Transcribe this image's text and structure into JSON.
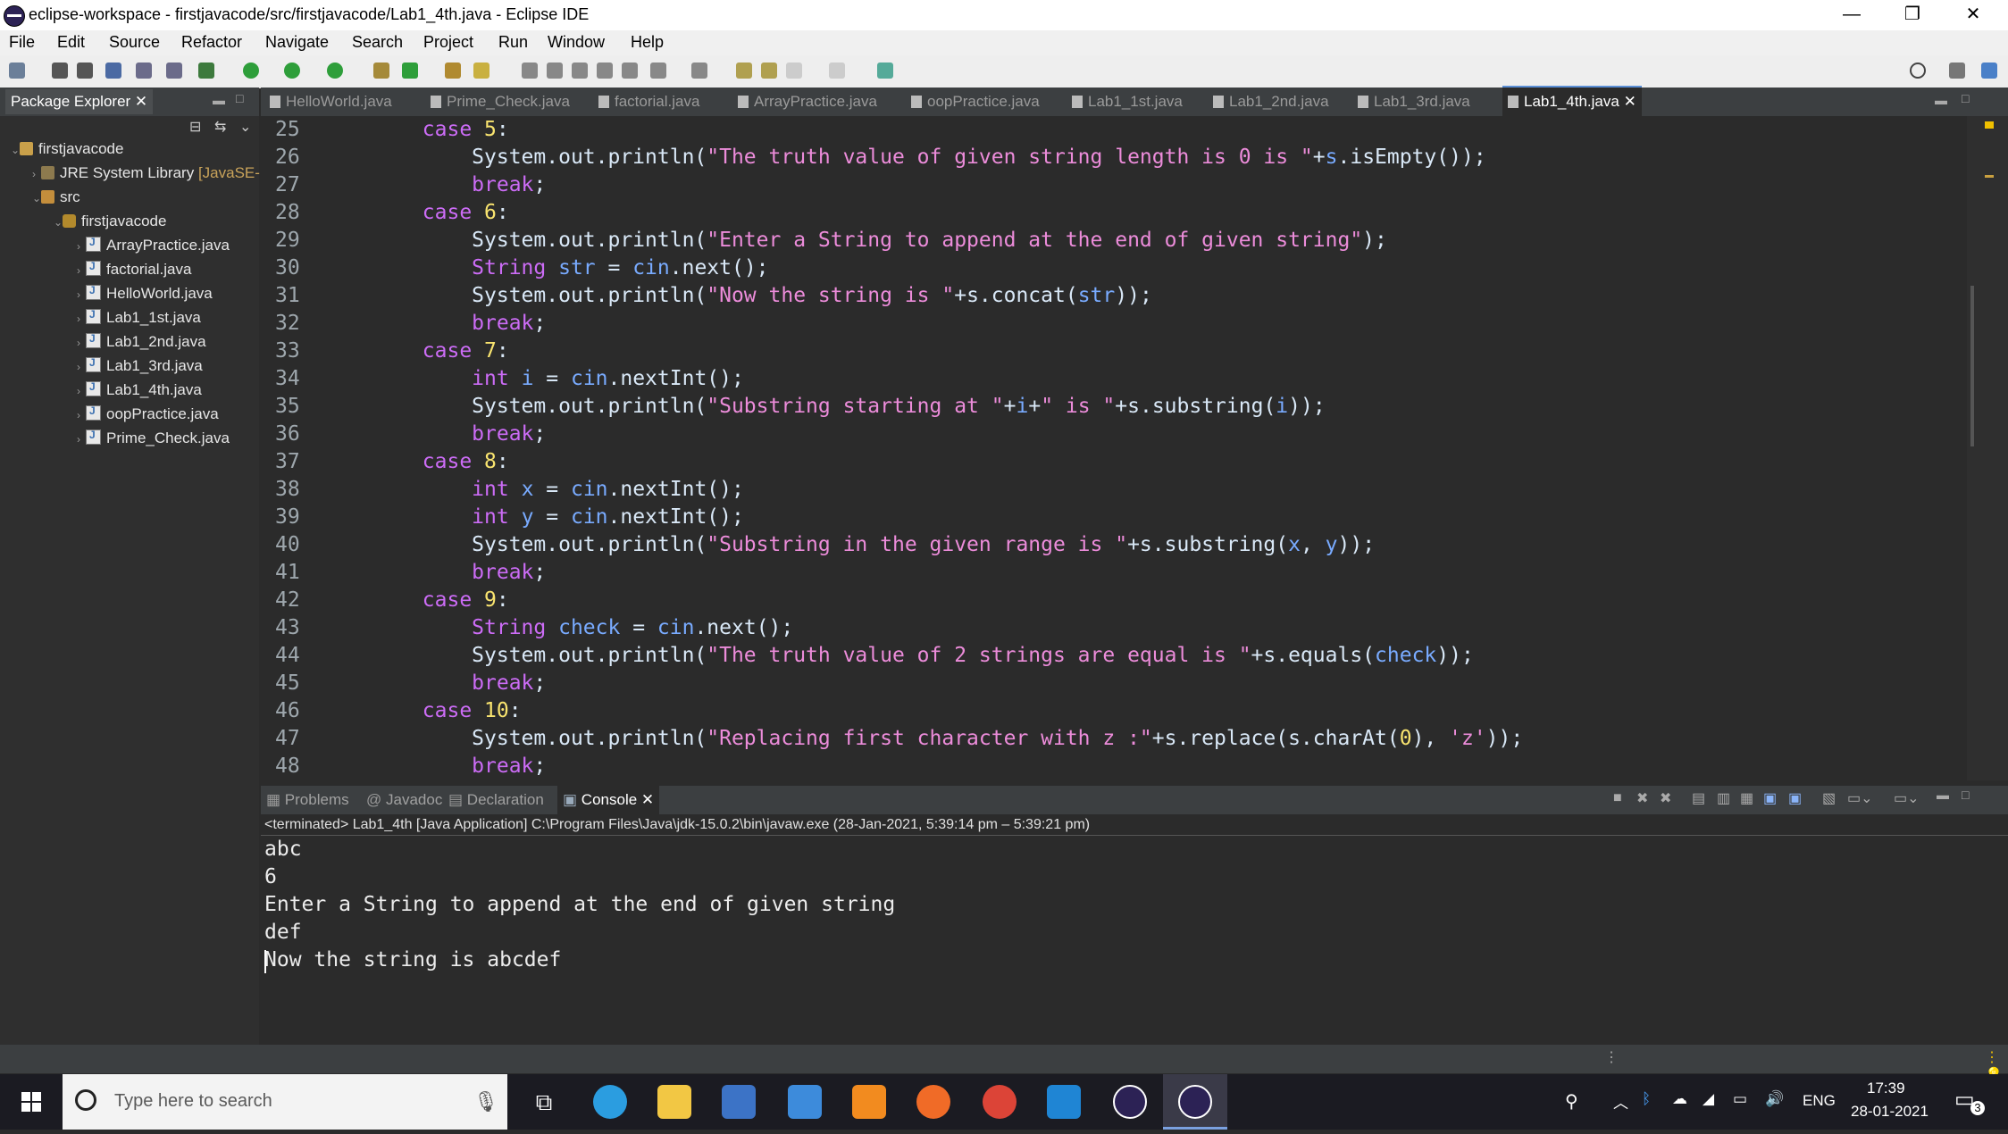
{
  "window": {
    "title": "eclipse-workspace - firstjavacode/src/firstjavacode/Lab1_4th.java - Eclipse IDE",
    "minimize": "—",
    "maximize": "❐",
    "close": "✕"
  },
  "menu": [
    "File",
    "Edit",
    "Source",
    "Refactor",
    "Navigate",
    "Search",
    "Project",
    "Run",
    "Window",
    "Help"
  ],
  "package_explorer": {
    "tab_label": "Package Explorer",
    "tree": [
      {
        "label": "firstjavacode",
        "icon": "project-icon",
        "level": 0
      },
      {
        "label": "JRE System Library",
        "suffix": "[JavaSE-",
        "icon": "library-icon",
        "level": 1
      },
      {
        "label": "src",
        "icon": "source-folder-icon",
        "level": 1
      },
      {
        "label": "firstjavacode",
        "icon": "package-icon",
        "level": 2
      },
      {
        "label": "ArrayPractice.java",
        "icon": "java-file-icon",
        "level": 3
      },
      {
        "label": "factorial.java",
        "icon": "java-file-icon",
        "level": 3
      },
      {
        "label": "HelloWorld.java",
        "icon": "java-file-icon",
        "level": 3
      },
      {
        "label": "Lab1_1st.java",
        "icon": "java-file-icon",
        "level": 3
      },
      {
        "label": "Lab1_2nd.java",
        "icon": "java-file-icon",
        "level": 3
      },
      {
        "label": "Lab1_3rd.java",
        "icon": "java-file-icon",
        "level": 3
      },
      {
        "label": "Lab1_4th.java",
        "icon": "java-file-icon",
        "level": 3
      },
      {
        "label": "oopPractice.java",
        "icon": "java-file-icon",
        "level": 3
      },
      {
        "label": "Prime_Check.java",
        "icon": "java-file-icon",
        "level": 3
      }
    ]
  },
  "editor_tabs": [
    "HelloWorld.java",
    "Prime_Check.java",
    "factorial.java",
    "ArrayPractice.java",
    "oopPractice.java",
    "Lab1_1st.java",
    "Lab1_2nd.java",
    "Lab1_3rd.java",
    "Lab1_4th.java"
  ],
  "active_tab": "Lab1_4th.java",
  "code_lines": [
    {
      "n": "25",
      "segs": [
        [
          "        ",
          "def"
        ],
        [
          "case ",
          "kw"
        ],
        [
          "5",
          "num"
        ],
        [
          ":",
          "def"
        ]
      ]
    },
    {
      "n": "26",
      "segs": [
        [
          "            System.out.println(",
          "def"
        ],
        [
          "\"The truth value of given string length is 0 is \"",
          "str"
        ],
        [
          "+",
          "def"
        ],
        [
          "s",
          ""
        ],
        [
          ".isEmpty());",
          "def"
        ]
      ]
    },
    {
      "n": "27",
      "segs": [
        [
          "            ",
          "def"
        ],
        [
          "break",
          ""
        ],
        [
          ";",
          "def"
        ]
      ]
    },
    {
      "n": "28",
      "segs": [
        [
          "        ",
          "def"
        ],
        [
          "case ",
          "kw"
        ],
        [
          "6",
          "num"
        ],
        [
          ":",
          "def"
        ]
      ]
    },
    {
      "n": "29",
      "segs": [
        [
          "            System.out.println(",
          "def"
        ],
        [
          "\"Enter a String to append at the end of given string\"",
          "str"
        ],
        [
          ");",
          "def"
        ]
      ]
    },
    {
      "n": "30",
      "segs": [
        [
          "            ",
          "def"
        ],
        [
          "String ",
          ""
        ],
        [
          "str ",
          "var"
        ],
        [
          "= ",
          "def"
        ],
        [
          "cin",
          "var"
        ],
        [
          ".next();",
          "def"
        ]
      ]
    },
    {
      "n": "31",
      "segs": [
        [
          "            System.out.println(",
          "def"
        ],
        [
          "\"Now the string is \"",
          "str"
        ],
        [
          "+s.concat(",
          "def"
        ],
        [
          "str",
          "var"
        ],
        [
          "));",
          "def"
        ]
      ]
    },
    {
      "n": "32",
      "segs": [
        [
          "            ",
          "def"
        ],
        [
          "break",
          ""
        ],
        [
          ";",
          "def"
        ]
      ]
    },
    {
      "n": "33",
      "segs": [
        [
          "        ",
          "def"
        ],
        [
          "case ",
          "kw"
        ],
        [
          "7",
          "num"
        ],
        [
          ":",
          "def"
        ]
      ]
    },
    {
      "n": "34",
      "segs": [
        [
          "            ",
          "def"
        ],
        [
          "int ",
          ""
        ],
        [
          "i ",
          "var"
        ],
        [
          "= ",
          "def"
        ],
        [
          "cin",
          "var"
        ],
        [
          ".nextInt();",
          "def"
        ]
      ]
    },
    {
      "n": "35",
      "segs": [
        [
          "            System.out.println(",
          "def"
        ],
        [
          "\"Substring starting at \"",
          "str"
        ],
        [
          "+",
          "def"
        ],
        [
          "i",
          "var"
        ],
        [
          "+",
          "def"
        ],
        [
          "\" is \"",
          "str"
        ],
        [
          "+s.substring(",
          "def"
        ],
        [
          "i",
          "var"
        ],
        [
          "));",
          "def"
        ]
      ]
    },
    {
      "n": "36",
      "segs": [
        [
          "            ",
          "def"
        ],
        [
          "break",
          ""
        ],
        [
          ";",
          "def"
        ]
      ]
    },
    {
      "n": "37",
      "segs": [
        [
          "        ",
          "def"
        ],
        [
          "case ",
          "kw"
        ],
        [
          "8",
          "num"
        ],
        [
          ":",
          "def"
        ]
      ]
    },
    {
      "n": "38",
      "segs": [
        [
          "            ",
          "def"
        ],
        [
          "int ",
          ""
        ],
        [
          "x ",
          "var"
        ],
        [
          "= ",
          "def"
        ],
        [
          "cin",
          "var"
        ],
        [
          ".nextInt();",
          "def"
        ]
      ]
    },
    {
      "n": "39",
      "segs": [
        [
          "            ",
          "def"
        ],
        [
          "int ",
          ""
        ],
        [
          "y ",
          "var"
        ],
        [
          "= ",
          "def"
        ],
        [
          "cin",
          "var"
        ],
        [
          ".nextInt();",
          "def"
        ]
      ]
    },
    {
      "n": "40",
      "segs": [
        [
          "            System.out.println(",
          "def"
        ],
        [
          "\"Substring in the given range is \"",
          "str"
        ],
        [
          "+s.substring(",
          "def"
        ],
        [
          "x",
          "var"
        ],
        [
          ", ",
          "def"
        ],
        [
          "y",
          "var"
        ],
        [
          "));",
          "def"
        ]
      ]
    },
    {
      "n": "41",
      "segs": [
        [
          "            ",
          "def"
        ],
        [
          "break",
          ""
        ],
        [
          ";",
          "def"
        ]
      ]
    },
    {
      "n": "42",
      "segs": [
        [
          "        ",
          "def"
        ],
        [
          "case ",
          "kw"
        ],
        [
          "9",
          "num"
        ],
        [
          ":",
          "def"
        ]
      ]
    },
    {
      "n": "43",
      "segs": [
        [
          "            ",
          "def"
        ],
        [
          "String ",
          ""
        ],
        [
          "check ",
          "var"
        ],
        [
          "= ",
          "def"
        ],
        [
          "cin",
          "var"
        ],
        [
          ".next();",
          "def"
        ]
      ]
    },
    {
      "n": "44",
      "segs": [
        [
          "            System.out.println(",
          "def"
        ],
        [
          "\"The truth value of 2 strings are equal is \"",
          "str"
        ],
        [
          "+s.equals(",
          "def"
        ],
        [
          "check",
          "var"
        ],
        [
          "));",
          "def"
        ]
      ]
    },
    {
      "n": "45",
      "segs": [
        [
          "            ",
          "def"
        ],
        [
          "break",
          ""
        ],
        [
          ";",
          "def"
        ]
      ]
    },
    {
      "n": "46",
      "segs": [
        [
          "        ",
          "def"
        ],
        [
          "case ",
          "kw"
        ],
        [
          "10",
          "num"
        ],
        [
          ":",
          "def"
        ]
      ]
    },
    {
      "n": "47",
      "segs": [
        [
          "            System.out.println(",
          "def"
        ],
        [
          "\"Replacing first character with z :\"",
          "str"
        ],
        [
          "+s.replace(s.charAt(",
          "def"
        ],
        [
          "0",
          "num"
        ],
        [
          "), ",
          "def"
        ],
        [
          "'z'",
          "str"
        ],
        [
          "));",
          "def"
        ]
      ]
    },
    {
      "n": "48",
      "segs": [
        [
          "            ",
          "def"
        ],
        [
          "break",
          ""
        ],
        [
          ";",
          "def"
        ]
      ]
    }
  ],
  "bottom_tabs": [
    "Problems",
    "Javadoc",
    "Declaration",
    "Console"
  ],
  "active_bottom_tab": "Console",
  "console": {
    "header": "<terminated> Lab1_4th [Java Application] C:\\Program Files\\Java\\jdk-15.0.2\\bin\\javaw.exe  (28-Jan-2021, 5:39:14 pm – 5:39:21 pm)",
    "lines": [
      "abc",
      "6",
      "Enter a String to append at the end of given string",
      "def",
      "Now the string is abcdef"
    ]
  },
  "taskbar": {
    "search_placeholder": "Type here to search",
    "apps": [
      "task-view",
      "edge",
      "file-explorer",
      "store",
      "mail",
      "sublime-text",
      "firefox",
      "chrome",
      "vscode",
      "eclipse",
      "eclipse-active"
    ],
    "language": "ENG",
    "time": "17:39",
    "date": "28-01-2021",
    "notifications": "3"
  },
  "colors": {
    "keyword": "#cc6cf6",
    "string": "#ec8cda",
    "number": "#f9e46f",
    "variable": "#79abff",
    "default": "#d9e8f7",
    "editor_bg": "#2b2b2b"
  }
}
